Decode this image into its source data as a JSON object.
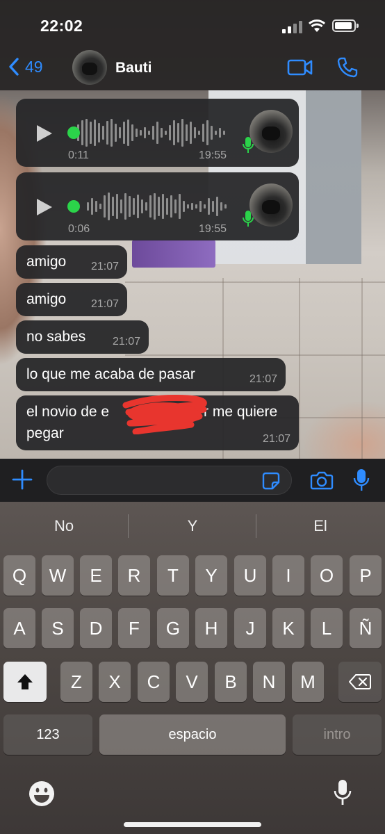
{
  "status": {
    "time": "22:02"
  },
  "header": {
    "back_count": "49",
    "contact_name": "Bauti"
  },
  "voice_notes": [
    {
      "duration": "0:11",
      "timestamp": "19:55"
    },
    {
      "duration": "0:06",
      "timestamp": "19:55"
    }
  ],
  "messages": [
    {
      "text": "amigo",
      "time": "21:07"
    },
    {
      "text": "amigo",
      "time": "21:07"
    },
    {
      "text": "no sabes",
      "time": "21:07"
    },
    {
      "text": "lo que me acaba de pasar",
      "time": "21:07"
    },
    {
      "text": "el novio de e",
      "text_after": "r me quiere",
      "text_line2": "pegar",
      "time": "21:07"
    }
  ],
  "keyboard": {
    "suggestions": [
      "No",
      "Y",
      "El"
    ],
    "row1": [
      "Q",
      "W",
      "E",
      "R",
      "T",
      "Y",
      "U",
      "I",
      "O",
      "P"
    ],
    "row2": [
      "A",
      "S",
      "D",
      "F",
      "G",
      "H",
      "J",
      "K",
      "L",
      "Ñ"
    ],
    "row3": [
      "Z",
      "X",
      "C",
      "V",
      "B",
      "N",
      "M"
    ],
    "numbers_label": "123",
    "space_label": "espacio",
    "return_label": "intro"
  },
  "colors": {
    "accent": "#2f8cff",
    "voice_dot": "#2bd44a",
    "redaction": "#e8352e"
  }
}
